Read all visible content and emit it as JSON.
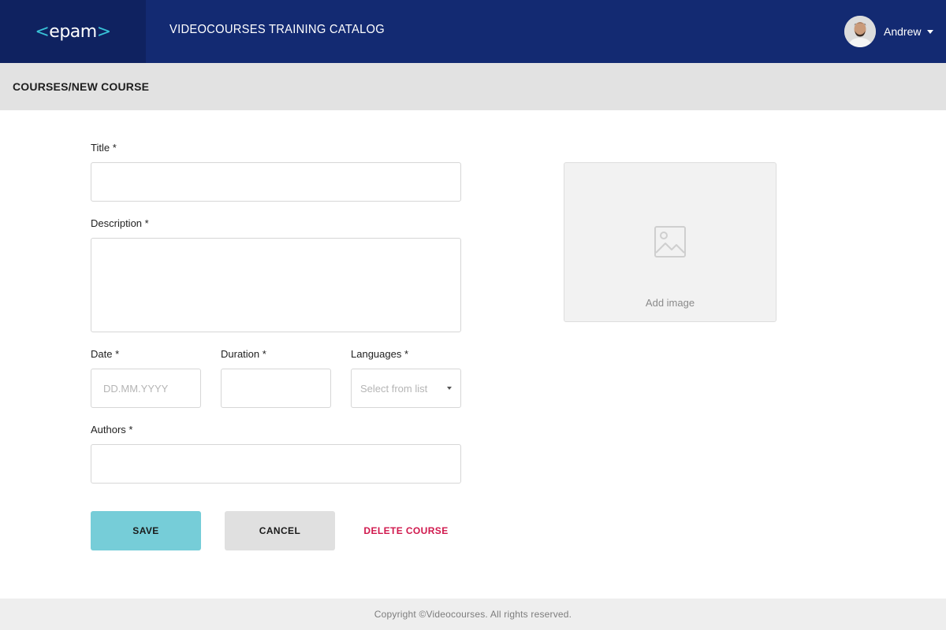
{
  "header": {
    "logo": {
      "left_bracket": "<",
      "text": "epam",
      "right_bracket": ">"
    },
    "title": "VIDEOCOURSES TRAINING CATALOG",
    "user": {
      "name": "Andrew",
      "avatar_icon": "user-avatar-icon",
      "menu_icon": "caret-down-icon"
    }
  },
  "breadcrumb": "COURSES/NEW COURSE",
  "form": {
    "title": {
      "label": "Title *",
      "value": "",
      "placeholder": ""
    },
    "description": {
      "label": "Description *",
      "value": "",
      "placeholder": ""
    },
    "date": {
      "label": "Date *",
      "value": "",
      "placeholder": "DD.MM.YYYY"
    },
    "duration": {
      "label": "Duration *",
      "value": "",
      "placeholder": ""
    },
    "languages": {
      "label": "Languages *",
      "placeholder": "Select from list",
      "icon": "caret-down-icon"
    },
    "authors": {
      "label": "Authors *",
      "value": "",
      "placeholder": ""
    }
  },
  "image_upload": {
    "caption": "Add image",
    "icon": "image-placeholder-icon"
  },
  "actions": {
    "save_label": "SAVE",
    "cancel_label": "CANCEL",
    "delete_label": "DELETE COURSE"
  },
  "footer": {
    "text": "Copyright ©Videocourses. All rights reserved."
  },
  "colors": {
    "header_bg": "#132a72",
    "logo_bg": "#0f2260",
    "logo_accent": "#39c2d7",
    "save_button": "#76cdd8",
    "delete_text": "#d0174c"
  }
}
